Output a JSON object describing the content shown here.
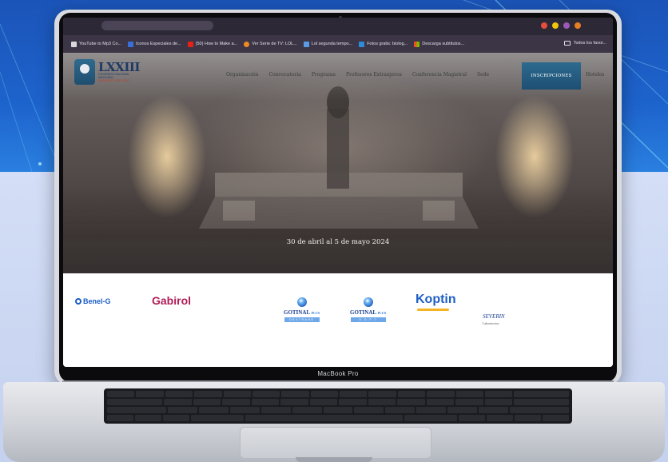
{
  "device": {
    "model_label": "MacBook Pro"
  },
  "browser": {
    "bookmarks": [
      {
        "label": "YouTube to Mp3 Co...",
        "color": "#d9d9d9"
      },
      {
        "label": "Iconos Especiales de...",
        "color": "#3b6fd8"
      },
      {
        "label": "(50) How to Make a...",
        "color": "#e62117"
      },
      {
        "label": "Ver Serie de TV: LOL...",
        "color": "#f08a24"
      },
      {
        "label": "Lol segunda tempo...",
        "color": "#5a9be8"
      },
      {
        "label": "Fotos gratis: biolog...",
        "color": "#2f8ad8"
      },
      {
        "label": "Descarga subtitulos...",
        "color": "#f2b824"
      }
    ],
    "bookmarks_folder": "Todos los favor..."
  },
  "site": {
    "logo": {
      "roman": "LXXIII",
      "subtitle": "CONGRESO NACIONAL MEXICANO",
      "city": "VERACRUZ, VER. 2024"
    },
    "nav": [
      "Organización",
      "Convocatoria",
      "Programa",
      "Profesores Extranjeros",
      "Conferencia Magistral",
      "Sede"
    ],
    "cta_label": "INSCRIPCIONES",
    "nav_extra": "Hoteles",
    "event_dates": "30 de abril al 5 de mayo 2024",
    "sponsors": {
      "benel": "Benel-G",
      "gabirol": "Gabirol",
      "gotinal_1": {
        "name": "GOTINAL",
        "suffix": "Pl.US",
        "band": "DEXTRANS"
      },
      "gotinal_2": {
        "name": "GOTINAL",
        "suffix": "Pl.US",
        "band": "S.O.F.T"
      },
      "koptin": "Koptin",
      "severin": {
        "name": "SEVERIN",
        "tag": "Laboratorios"
      }
    }
  },
  "colors": {
    "bg_blue": "#1d63cc",
    "cta_teal": "#2d6a8e",
    "gabirol_magenta": "#b01c56",
    "benel_blue": "#1b5cc8",
    "koptin_blue": "#1e5fc4"
  }
}
